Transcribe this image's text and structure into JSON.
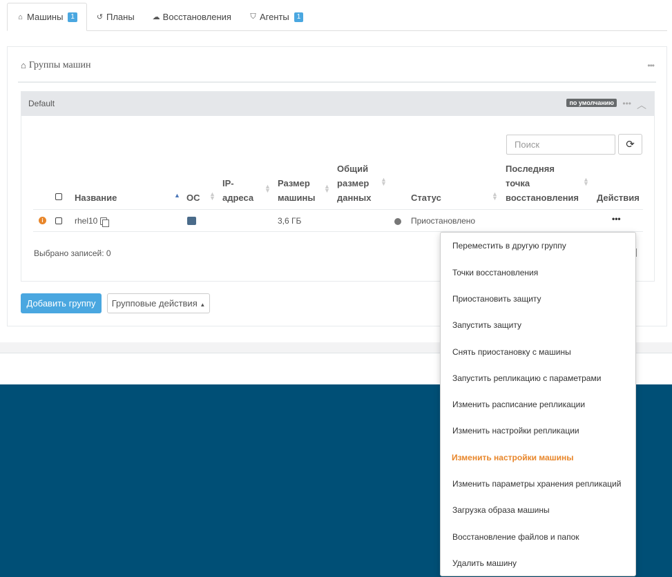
{
  "tabs": [
    {
      "label": "Машины",
      "icon": "home-icon",
      "badge": "1"
    },
    {
      "label": "Планы",
      "icon": "history-icon"
    },
    {
      "label": "Восстановления",
      "icon": "cloud-icon"
    },
    {
      "label": "Агенты",
      "icon": "shield-icon",
      "badge": "1"
    }
  ],
  "panel": {
    "title": "Группы машин"
  },
  "group": {
    "name": "Default",
    "default_badge": "по умолчанию"
  },
  "search": {
    "placeholder": "Поиск"
  },
  "table": {
    "headers": {
      "name": "Название",
      "os": "ОС",
      "ip_line1": "IP-",
      "ip_line2": "адреса",
      "size_line1": "Размер",
      "size_line2": "машины",
      "total_line1": "Общий",
      "total_line2": "размер",
      "total_line3": "данных",
      "status": "Статус",
      "last_line1": "Последняя",
      "last_line2": "точка",
      "last_line3": "восстановления",
      "actions": "Действия"
    },
    "rows": [
      {
        "name": "rhel10",
        "os_icon": "linux-icon",
        "ip": "",
        "size": "3,6 ГБ",
        "total": "",
        "status": "Приостановлено",
        "last": ""
      }
    ],
    "selected_count": "Выбрано записей: 0"
  },
  "buttons": {
    "add_group": "Добавить группу",
    "bulk_actions": "Групповые действия"
  },
  "menu": {
    "items": [
      "Переместить в другую группу",
      "Точки восстановления",
      "Приостановить защиту",
      "Запустить защиту",
      "Снять приостановку с машины",
      "Запустить репликацию с параметрами",
      "Изменить расписание репликации",
      "Изменить настройки репликации",
      "Изменить настройки машины",
      "Изменить параметры хранения репликаций",
      "Загрузка образа машины",
      "Восстановление файлов и папок",
      "Удалить машину"
    ],
    "highlighted": "Изменить настройки машины"
  },
  "colors": {
    "accent": "#4aa7e0",
    "highlight": "#e8862a",
    "footer": "#004f76",
    "group_header": "#e5e7ea"
  }
}
